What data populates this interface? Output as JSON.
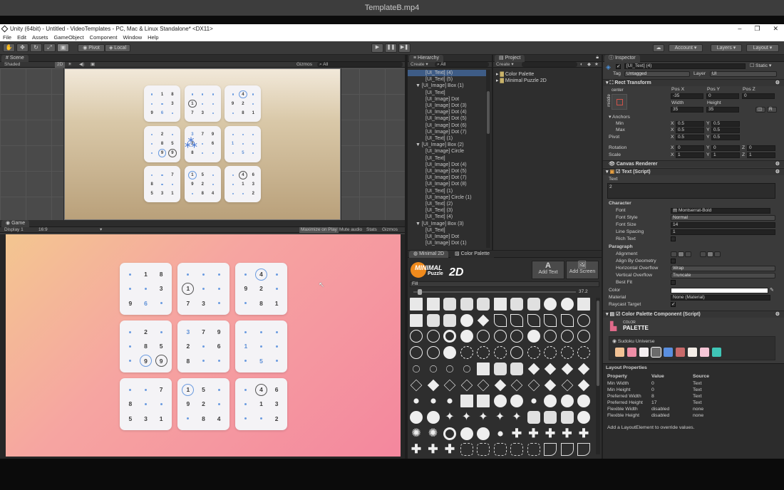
{
  "video_title": "TemplateB.mp4",
  "window": {
    "title": "Unity (64bit) - Untitled - VideoTemplates - PC, Mac & Linux Standalone* <DX11>",
    "controls": [
      "–",
      "❐",
      "✕"
    ]
  },
  "menu": [
    "File",
    "Edit",
    "Assets",
    "GameObject",
    "Component",
    "Window",
    "Help"
  ],
  "toolbar": {
    "pivot": "Pivot",
    "local": "Local",
    "play_icon": "play-icon",
    "pause_icon": "pause-icon",
    "step_icon": "step-icon",
    "account": "Account",
    "layers": "Layers",
    "layout": "Layout"
  },
  "scene": {
    "tab": "Scene",
    "shaded": "Shaded",
    "mode2d": "2D",
    "gizmos": "Gizmos",
    "search": "All"
  },
  "game": {
    "tab": "Game",
    "display": "Display 1",
    "aspect": "16:9",
    "maximize": "Maximize on Play",
    "mute": "Mute audio",
    "stats": "Stats",
    "gizmos": "Gizmos"
  },
  "sudoku": [
    [
      {
        "t": "d"
      },
      {
        "t": "n",
        "v": "1"
      },
      {
        "t": "n",
        "v": "8"
      },
      {
        "t": "d"
      },
      {
        "t": "d"
      },
      {
        "t": "n",
        "v": "3"
      },
      {
        "t": "n",
        "v": "9"
      },
      {
        "t": "n",
        "v": "6",
        "c": "blue"
      },
      {
        "t": "d"
      }
    ],
    [
      {
        "t": "d"
      },
      {
        "t": "d"
      },
      {
        "t": "d"
      },
      {
        "t": "c",
        "v": "1"
      },
      {
        "t": "d"
      },
      {
        "t": "d"
      },
      {
        "t": "n",
        "v": "7"
      },
      {
        "t": "n",
        "v": "3"
      },
      {
        "t": "d"
      }
    ],
    [
      {
        "t": "d"
      },
      {
        "t": "cb",
        "v": "4"
      },
      {
        "t": "d"
      },
      {
        "t": "n",
        "v": "9"
      },
      {
        "t": "n",
        "v": "2"
      },
      {
        "t": "d"
      },
      {
        "t": "d"
      },
      {
        "t": "n",
        "v": "8"
      },
      {
        "t": "n",
        "v": "1"
      }
    ],
    [
      {
        "t": "d"
      },
      {
        "t": "n",
        "v": "2"
      },
      {
        "t": "d"
      },
      {
        "t": "d"
      },
      {
        "t": "n",
        "v": "8"
      },
      {
        "t": "n",
        "v": "5"
      },
      {
        "t": "d"
      },
      {
        "t": "cb",
        "v": "9"
      },
      {
        "t": "c",
        "v": "9"
      }
    ],
    [
      {
        "t": "n",
        "v": "3",
        "c": "blue"
      },
      {
        "t": "n",
        "v": "7"
      },
      {
        "t": "n",
        "v": "9"
      },
      {
        "t": "n",
        "v": "2"
      },
      {
        "t": "d"
      },
      {
        "t": "n",
        "v": "6"
      },
      {
        "t": "n",
        "v": "8"
      },
      {
        "t": "d"
      },
      {
        "t": "d"
      }
    ],
    [
      {
        "t": "d"
      },
      {
        "t": "d"
      },
      {
        "t": "d"
      },
      {
        "t": "n",
        "v": "1",
        "c": "blue"
      },
      {
        "t": "d"
      },
      {
        "t": "d"
      },
      {
        "t": "d"
      },
      {
        "t": "n",
        "v": "5",
        "c": "blue"
      },
      {
        "t": "d"
      }
    ],
    [
      {
        "t": "d"
      },
      {
        "t": "d"
      },
      {
        "t": "n",
        "v": "7"
      },
      {
        "t": "n",
        "v": "8"
      },
      {
        "t": "d"
      },
      {
        "t": "d"
      },
      {
        "t": "n",
        "v": "5"
      },
      {
        "t": "n",
        "v": "3"
      },
      {
        "t": "n",
        "v": "1"
      }
    ],
    [
      {
        "t": "cb",
        "v": "1"
      },
      {
        "t": "n",
        "v": "5"
      },
      {
        "t": "d"
      },
      {
        "t": "n",
        "v": "9"
      },
      {
        "t": "n",
        "v": "2"
      },
      {
        "t": "d"
      },
      {
        "t": "d"
      },
      {
        "t": "n",
        "v": "8"
      },
      {
        "t": "n",
        "v": "4"
      }
    ],
    [
      {
        "t": "d"
      },
      {
        "t": "c",
        "v": "4"
      },
      {
        "t": "n",
        "v": "6"
      },
      {
        "t": "d"
      },
      {
        "t": "n",
        "v": "1"
      },
      {
        "t": "n",
        "v": "3"
      },
      {
        "t": "d"
      },
      {
        "t": "d"
      },
      {
        "t": "n",
        "v": "2"
      }
    ]
  ],
  "hierarchy": {
    "tab": "Hierarchy",
    "create": "Create",
    "search": "All",
    "rows": [
      {
        "label": "[UI_Text] (4)",
        "indent": 1,
        "sel": true
      },
      {
        "label": "[UI_Text] (5)",
        "indent": 1
      },
      {
        "label": "▼ [UI_Image] Box (1)",
        "indent": 0
      },
      {
        "label": "[UI_Text]",
        "indent": 1
      },
      {
        "label": "[UI_Image] Dot",
        "indent": 1
      },
      {
        "label": "[UI_Image] Dot (3)",
        "indent": 1
      },
      {
        "label": "[UI_Image] Dot (4)",
        "indent": 1
      },
      {
        "label": "[UI_Image] Dot (5)",
        "indent": 1
      },
      {
        "label": "[UI_Image] Dot (6)",
        "indent": 1
      },
      {
        "label": "[UI_Image] Dot (7)",
        "indent": 1
      },
      {
        "label": "[UI_Text] (1)",
        "indent": 1
      },
      {
        "label": "▼ [UI_Image] Box (2)",
        "indent": 0
      },
      {
        "label": "[UI_Image] Circle",
        "indent": 1
      },
      {
        "label": "[UI_Text]",
        "indent": 1
      },
      {
        "label": "[UI_Image] Dot (4)",
        "indent": 1
      },
      {
        "label": "[UI_Image] Dot (5)",
        "indent": 1
      },
      {
        "label": "[UI_Image] Dot (7)",
        "indent": 1
      },
      {
        "label": "[UI_Image] Dot (8)",
        "indent": 1
      },
      {
        "label": "[UI_Text] (1)",
        "indent": 1
      },
      {
        "label": "[UI_Image] Circle (1)",
        "indent": 1
      },
      {
        "label": "[UI_Text] (2)",
        "indent": 1
      },
      {
        "label": "[UI_Text] (3)",
        "indent": 1
      },
      {
        "label": "[UI_Text] (4)",
        "indent": 1
      },
      {
        "label": "▼ [UI_Image] Box (3)",
        "indent": 0
      },
      {
        "label": "[UI_Text]",
        "indent": 1
      },
      {
        "label": "[UI_Image] Dot",
        "indent": 1
      },
      {
        "label": "[UI_Image] Dot (1)",
        "indent": 1
      }
    ]
  },
  "project": {
    "tab": "Project",
    "create": "Create",
    "folders": [
      "Color Palette",
      "Minimal Puzzle 2D"
    ]
  },
  "minimal": {
    "tab1": "Minimal 2D",
    "tab2": "Color Palette",
    "logo_top": "MINIMAL",
    "logo_bottom": "Puzzle",
    "logo_2d": "2D",
    "add_text": "Add Text",
    "add_screen": "Add Screen",
    "fill": "Fill",
    "slider_value": "37.2"
  },
  "inspector": {
    "tab": "Inspector",
    "object_name": "[UI_Text] (4)",
    "static": "Static",
    "tag_label": "Tag",
    "tag": "Untagged",
    "layer_label": "Layer",
    "layer": "UI",
    "rect_transform": "Rect Transform",
    "anchor_center": "center",
    "anchor_middle": "middle",
    "posx_label": "Pos X",
    "posy_label": "Pos Y",
    "posz_label": "Pos Z",
    "posx": "-35",
    "posy": "0",
    "posz": "0",
    "width_label": "Width",
    "height_label": "Height",
    "width": "35",
    "height": "35",
    "anchors": "Anchors",
    "min": "Min",
    "max": "Max",
    "pivot": "Pivot",
    "anchor_min_x": "0.5",
    "anchor_min_y": "0.5",
    "anchor_max_x": "0.5",
    "anchor_max_y": "0.5",
    "pivot_x": "0.5",
    "pivot_y": "0.5",
    "rotation": "Rotation",
    "scale": "Scale",
    "rot_x": "0",
    "rot_y": "0",
    "rot_z": "0",
    "scale_x": "1",
    "scale_y": "1",
    "scale_z": "1",
    "axis_x": "X",
    "axis_y": "Y",
    "axis_z": "Z",
    "canvas_renderer": "Canvas Renderer",
    "text_script": "Text (Script)",
    "text_label": "Text",
    "text_value": "2",
    "character": "Character",
    "font_label": "Font",
    "font": "Montserrat-Bold",
    "font_style_label": "Font Style",
    "font_style": "Normal",
    "font_size_label": "Font Size",
    "font_size": "14",
    "line_spacing_label": "Line Spacing",
    "line_spacing": "1",
    "rich_text": "Rich Text",
    "paragraph": "Paragraph",
    "alignment": "Alignment",
    "align_geometry": "Align By Geometry",
    "h_overflow_label": "Horizontal Overflow",
    "h_overflow": "Wrap",
    "v_overflow_label": "Vertical Overflow",
    "v_overflow": "Truncate",
    "best_fit": "Best Fit",
    "color_label": "Color",
    "material_label": "Material",
    "material": "None (Material)",
    "raycast": "Raycast Target",
    "color_palette_script": "Color Palette Component (Script)",
    "palette_logo_top": "COLOR",
    "palette_logo": "PALETTE",
    "palette_name": "Sudoku Universe",
    "swatches": [
      "#f2c295",
      "#ee8ea6",
      "#f4eef0",
      "#6b6b6b",
      "#5a8fe0",
      "#c86a6a",
      "#f3ece6",
      "#f5c6d6",
      "#3fc6b7"
    ],
    "layout_props": "Layout Properties",
    "lp_headers": [
      "Property",
      "Value",
      "Source"
    ],
    "lp_rows": [
      [
        "Min Width",
        "0",
        "Text"
      ],
      [
        "Min Height",
        "0",
        "Text"
      ],
      [
        "Preferred Width",
        "8",
        "Text"
      ],
      [
        "Preferred Height",
        "17",
        "Text"
      ],
      [
        "Flexible Width",
        "disabled",
        "none"
      ],
      [
        "Flexible Height",
        "disabled",
        "none"
      ]
    ],
    "lp_hint": "Add a LayoutElement to override values."
  }
}
